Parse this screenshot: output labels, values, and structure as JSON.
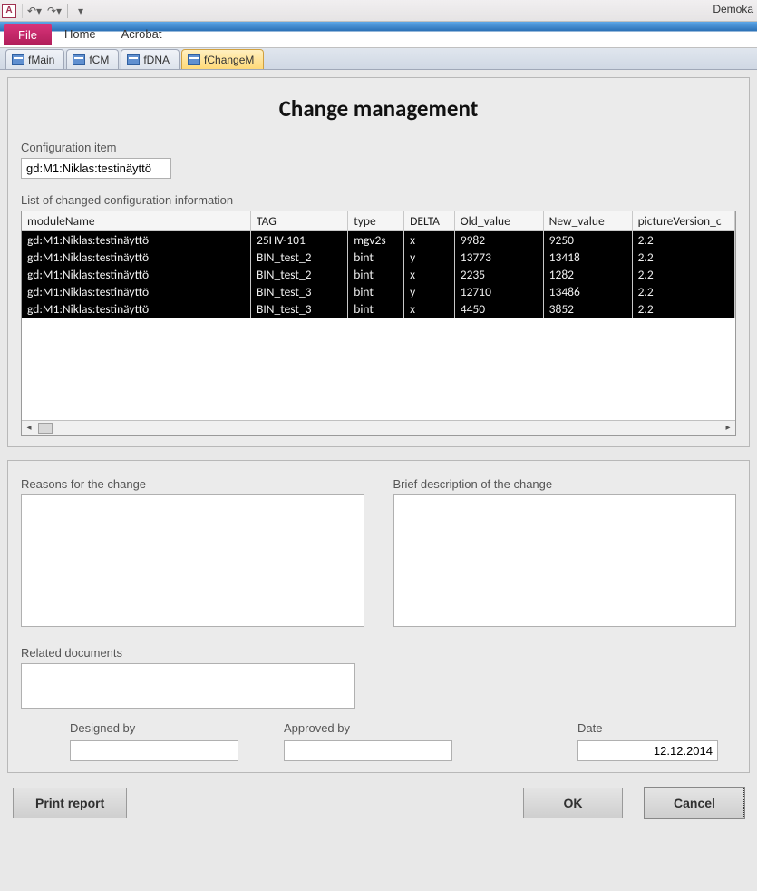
{
  "window_title": "Demoka",
  "qat": {
    "undo": "↶",
    "redo": "↷"
  },
  "ribbon": {
    "file": "File",
    "home": "Home",
    "acrobat": "Acrobat"
  },
  "doc_tabs": [
    "fMain",
    "fCM",
    "fDNA",
    "fChangeM"
  ],
  "active_tab": 3,
  "form": {
    "title": "Change management",
    "ci_label": "Configuration item",
    "ci_value": "gd:M1:Niklas:testinäyttö",
    "list_label": "List of changed configuration information",
    "columns": [
      "moduleName",
      "TAG",
      "type",
      "DELTA",
      "Old_value",
      "New_value",
      "pictureVersion_c"
    ],
    "rows": [
      [
        "gd:M1:Niklas:testinäyttö",
        "25HV-101",
        "mgv2s",
        "x",
        "9982",
        "9250",
        "2.2"
      ],
      [
        "gd:M1:Niklas:testinäyttö",
        "BIN_test_2",
        "bint",
        "y",
        "13773",
        "13418",
        "2.2"
      ],
      [
        "gd:M1:Niklas:testinäyttö",
        "BIN_test_2",
        "bint",
        "x",
        "2235",
        "1282",
        "2.2"
      ],
      [
        "gd:M1:Niklas:testinäyttö",
        "BIN_test_3",
        "bint",
        "y",
        "12710",
        "13486",
        "2.2"
      ],
      [
        "gd:M1:Niklas:testinäyttö",
        "BIN_test_3",
        "bint",
        "x",
        "4450",
        "3852",
        "2.2"
      ]
    ],
    "reasons_label": "Reasons for the change",
    "brief_label": "Brief description of the change",
    "related_label": "Related documents",
    "designed_label": "Designed by",
    "approved_label": "Approved by",
    "date_label": "Date",
    "date_value": "12.12.2014",
    "print_btn": "Print report",
    "ok_btn": "OK",
    "cancel_btn": "Cancel"
  }
}
